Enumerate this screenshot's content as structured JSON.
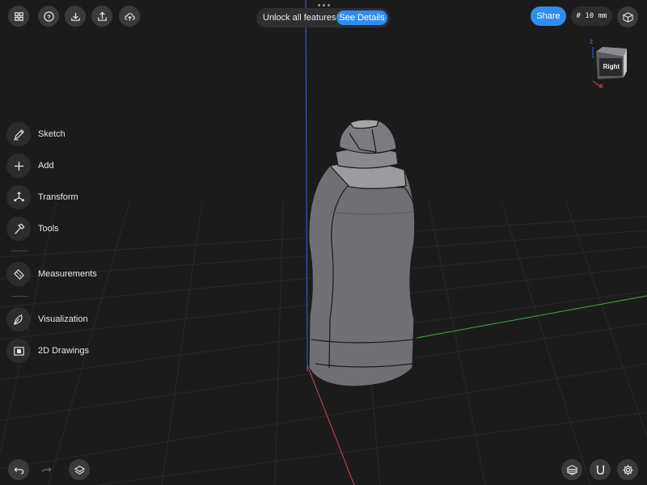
{
  "toolbar": {
    "buttons": [
      {
        "name": "grid-menu-icon"
      },
      {
        "name": "help-icon"
      },
      {
        "name": "import-icon"
      },
      {
        "name": "export-icon"
      },
      {
        "name": "cloud-upload-icon"
      }
    ],
    "promo_text": "Unlock all features",
    "promo_button": "See Details",
    "share_label": "Share",
    "grid_units": "# 10 mm"
  },
  "view_cube": {
    "face_label": "Right",
    "axis_z": "Z",
    "axis_x": "X"
  },
  "sidebar": {
    "tools": [
      {
        "label": "Sketch",
        "icon": "pencil-icon"
      },
      {
        "label": "Add",
        "icon": "plus-icon"
      },
      {
        "label": "Transform",
        "icon": "transform-arrows-icon"
      },
      {
        "label": "Tools",
        "icon": "hammer-icon"
      },
      {
        "label": "Measurements",
        "icon": "ruler-icon"
      },
      {
        "label": "Visualization",
        "icon": "visualization-icon"
      },
      {
        "label": "2D Drawings",
        "icon": "drawing-sheet-icon"
      }
    ]
  },
  "bottom": {
    "left": [
      "undo-icon",
      "redo-icon",
      "layers-icon"
    ],
    "right": [
      "section-view-icon",
      "snap-magnet-icon",
      "settings-gear-icon"
    ]
  },
  "colors": {
    "accent": "#2f8df0",
    "background": "#1b1b1c",
    "axis_x": "#c84a4a",
    "axis_y": "#46a546",
    "axis_z": "#3a66d6",
    "model": "#707074"
  }
}
